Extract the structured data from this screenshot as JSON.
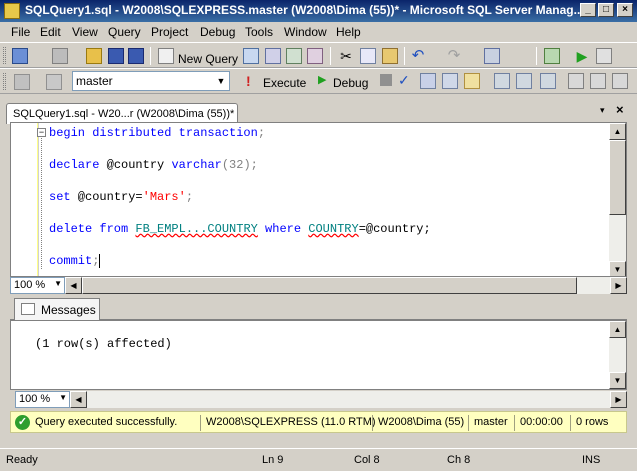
{
  "window": {
    "title": "SQLQuery1.sql - W2008\\SQLEXPRESS.master (W2008\\Dima (55))* - Microsoft SQL Server Manag...",
    "minimize": "_",
    "maximize": "□",
    "close": "×"
  },
  "menu": {
    "items": [
      "File",
      "Edit",
      "View",
      "Query",
      "Project",
      "Debug",
      "Tools",
      "Window",
      "Help"
    ]
  },
  "toolbar1": {
    "new_query": "New Query"
  },
  "toolbar2": {
    "database": "master",
    "execute": "Execute",
    "debug": "Debug"
  },
  "doc_tab": {
    "label": "SQLQuery1.sql - W20...r (W2008\\Dima (55))*",
    "close": "×",
    "dropdown": "▾"
  },
  "editor": {
    "lines": [
      {
        "kw1": "begin distributed transaction",
        "rest": ";"
      },
      {
        "kw1": "declare",
        "mid": " @country ",
        "kw2": "varchar",
        "rest": "(32);"
      },
      {
        "kw1": "set",
        "mid": " @country=",
        "str": "'Mars'",
        "rest": ";"
      },
      {
        "kw1": "delete from",
        "mid": " ",
        "obj": "FB_EMPL...COUNTRY",
        "kw2": " where ",
        "col": "COUNTRY",
        "rest": "=@country;"
      },
      {
        "kw1": "commit",
        "rest": ";"
      }
    ],
    "zoom": "100 %"
  },
  "results": {
    "tab_label": "Messages",
    "message": "(1 row(s) affected)",
    "zoom": "100 %"
  },
  "query_status": {
    "message": "Query executed successfully.",
    "server": "W2008\\SQLEXPRESS (11.0 RTM)",
    "user": "W2008\\Dima (55)",
    "database": "master",
    "elapsed": "00:00:00",
    "rows": "0 rows",
    "color": "#ffffc0"
  },
  "statusbar": {
    "ready": "Ready",
    "ln": "Ln 9",
    "col": "Col 8",
    "ch": "Ch 8",
    "ins": "INS"
  }
}
